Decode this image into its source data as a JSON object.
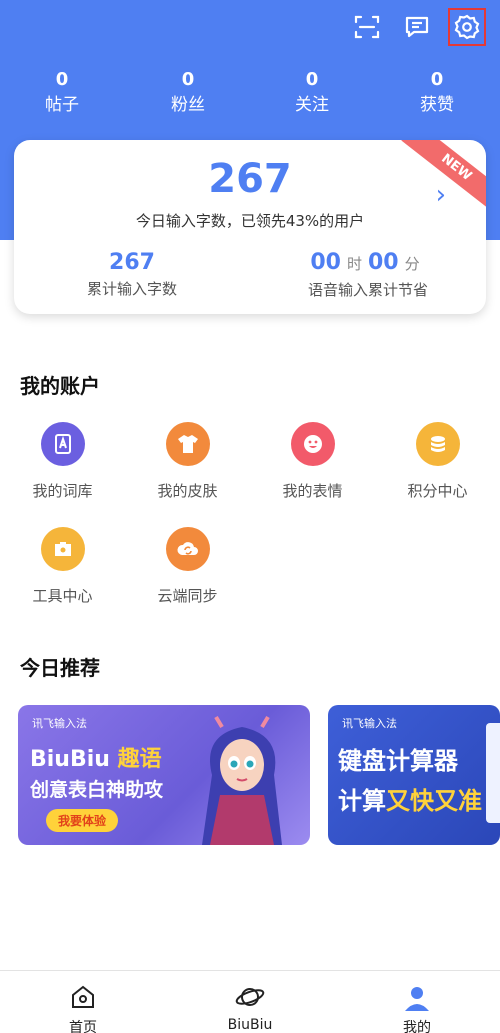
{
  "header": {
    "icons": [
      "scan-icon",
      "message-icon",
      "settings-icon"
    ],
    "accent_color": "#4f7ff2"
  },
  "stats": [
    {
      "value": "0",
      "label": "帖子"
    },
    {
      "value": "0",
      "label": "粉丝"
    },
    {
      "value": "0",
      "label": "关注"
    },
    {
      "value": "0",
      "label": "获赞"
    }
  ],
  "card": {
    "today_count": "267",
    "today_text": "今日输入字数，已领先43%的用户",
    "badge": "NEW",
    "total_count": "267",
    "total_label": "累计输入字数",
    "voice_hours": "00",
    "hour_unit": "时",
    "voice_minutes": "00",
    "minute_unit": "分",
    "voice_label": "语音输入累计节省"
  },
  "account": {
    "title": "我的账户",
    "items": [
      {
        "label": "我的词库",
        "icon": "dictionary-icon",
        "color": "#6b5fe0"
      },
      {
        "label": "我的皮肤",
        "icon": "skin-shirt-icon",
        "color": "#f28a3c"
      },
      {
        "label": "我的表情",
        "icon": "emoji-icon",
        "color": "#f25a6a"
      },
      {
        "label": "积分中心",
        "icon": "coins-icon",
        "color": "#f5b53a"
      },
      {
        "label": "工具中心",
        "icon": "toolbox-icon",
        "color": "#f5b53a"
      },
      {
        "label": "云端同步",
        "icon": "cloud-sync-icon",
        "color": "#f28a3c"
      }
    ]
  },
  "recommend": {
    "title": "今日推荐",
    "banner1": {
      "brand": "讯飞输入法",
      "title_part1": "BiuBiu",
      "title_part2": "趣语",
      "subtitle": "创意表白神助攻",
      "button": "我要体验"
    },
    "banner2": {
      "brand": "讯飞输入法",
      "title": "键盘计算器",
      "subtitle_part1": "计算",
      "subtitle_part2": "又快又准"
    }
  },
  "tabbar": [
    {
      "label": "首页",
      "icon": "home-icon"
    },
    {
      "label": "BiuBiu",
      "icon": "planet-icon"
    },
    {
      "label": "我的",
      "icon": "profile-icon"
    }
  ]
}
